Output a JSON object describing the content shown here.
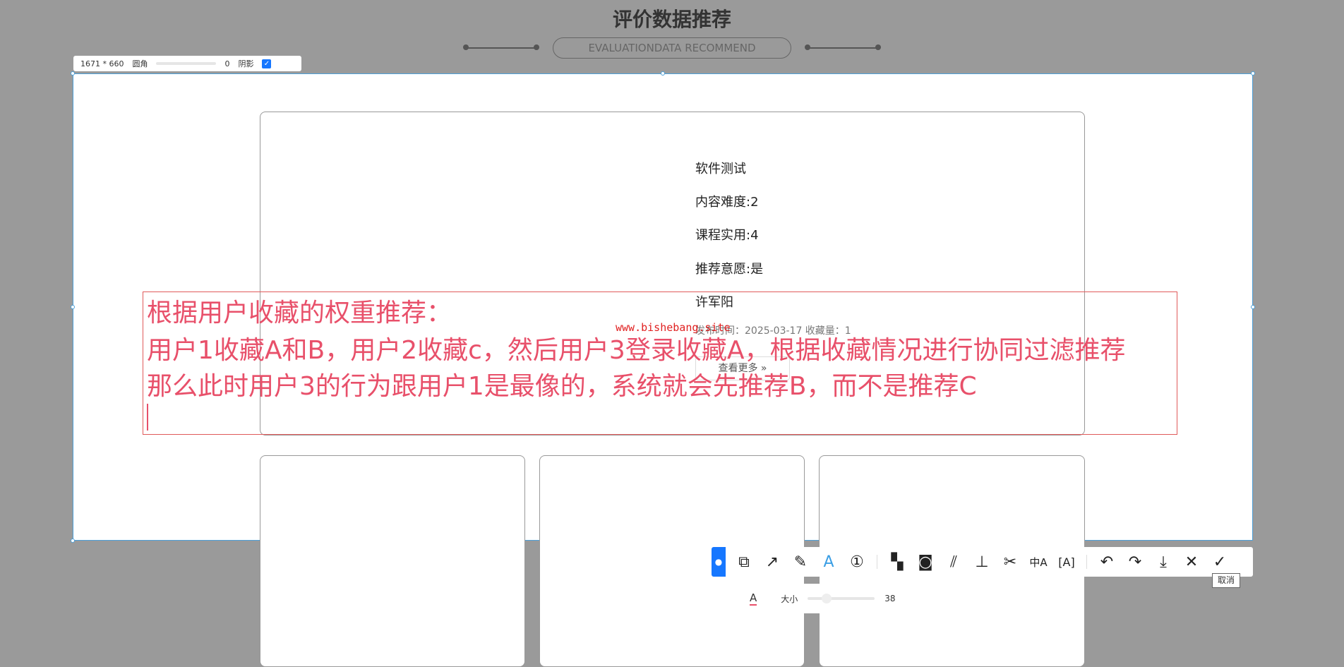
{
  "page": {
    "title": "评价数据推荐",
    "subtitle": "EVALUATIONDATA RECOMMEND"
  },
  "capture_bar": {
    "size": "1671 * 660",
    "radius_label": "圆角",
    "radius_value": "0",
    "shadow_label": "阴影",
    "shadow_checked": true
  },
  "card": {
    "lines": [
      "软件测试",
      "内容难度:2",
      "课程实用:4",
      "推荐意愿:是",
      "许军阳"
    ],
    "meta": "发布时间：2025-03-17  收藏量：1",
    "more_button": "查看更多 »"
  },
  "annotation": {
    "lines": [
      "根据用户收藏的权重推荐：",
      "用户1收藏A和B，用户2收藏c，然后用户3登录收藏A，根据收藏情况进行协同过滤推荐",
      "那么此时用户3的行为跟用户1是最像的，系统就会先推荐B，而不是推荐C"
    ],
    "color": "#e8506a"
  },
  "watermark": "www.bishebang.site",
  "toolbar": {
    "icons": [
      "shape-icon",
      "arrow-icon",
      "pencil-icon",
      "text-icon",
      "number-icon",
      "mosaic-icon",
      "blur-icon",
      "hatch-icon",
      "pin-icon",
      "cut-icon",
      "translate-icon",
      "ocr-icon",
      "undo-icon",
      "redo-icon",
      "download-icon",
      "close-icon",
      "confirm-icon"
    ],
    "tooltip": "取消"
  },
  "text_panel": {
    "color_label": "A",
    "size_label": "大小",
    "size_value": "38"
  }
}
